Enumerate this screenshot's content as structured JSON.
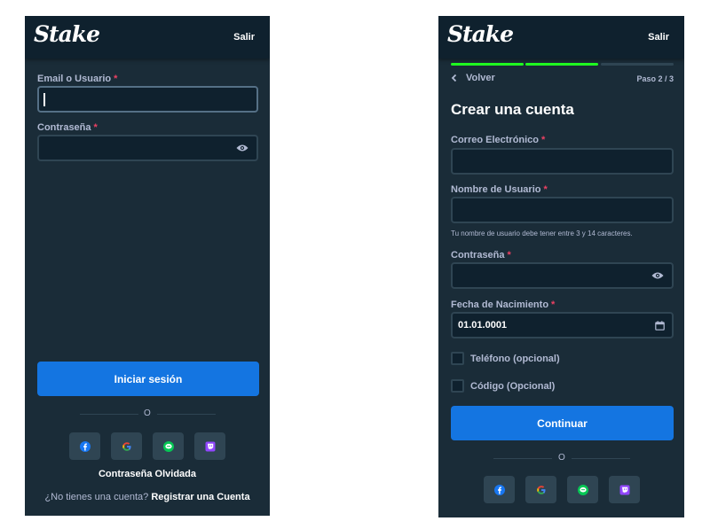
{
  "login": {
    "brand": "Stake",
    "close_label": "Salir",
    "email_label": "Email o Usuario",
    "password_label": "Contraseña",
    "required_mark": "*",
    "submit_label": "Iniciar sesión",
    "or_label": "O",
    "socials": [
      "facebook-icon",
      "google-icon",
      "line-icon",
      "twitch-icon"
    ],
    "forgot_label": "Contraseña Olvidada",
    "no_account_text": "¿No tienes una cuenta?",
    "register_label": "Registrar una Cuenta"
  },
  "register": {
    "brand": "Stake",
    "close_label": "Salir",
    "back_label": "Volver",
    "step_text": "Paso 2 / 3",
    "steps_completed": 2,
    "steps_total": 3,
    "title": "Crear una cuenta",
    "required_mark": "*",
    "email_label": "Correo Electrónico",
    "username_label": "Nombre de Usuario",
    "username_hint": "Tu nombre de usuario debe tener entre 3 y 14 caracteres.",
    "password_label": "Contraseña",
    "dob_label": "Fecha de Nacimiento",
    "dob_value": "01.01.0001",
    "phone_label": "Teléfono (opcional)",
    "code_label": "Código (Opcional)",
    "submit_label": "Continuar",
    "or_label": "O"
  },
  "colors": {
    "panel_bg": "#1a2c38",
    "topbar_bg": "#0f212e",
    "input_border": "#2f4553",
    "accent_blue": "#1475e1",
    "progress_green": "#1fff20",
    "required_red": "#ed4163",
    "muted_text": "#b1bad3"
  }
}
